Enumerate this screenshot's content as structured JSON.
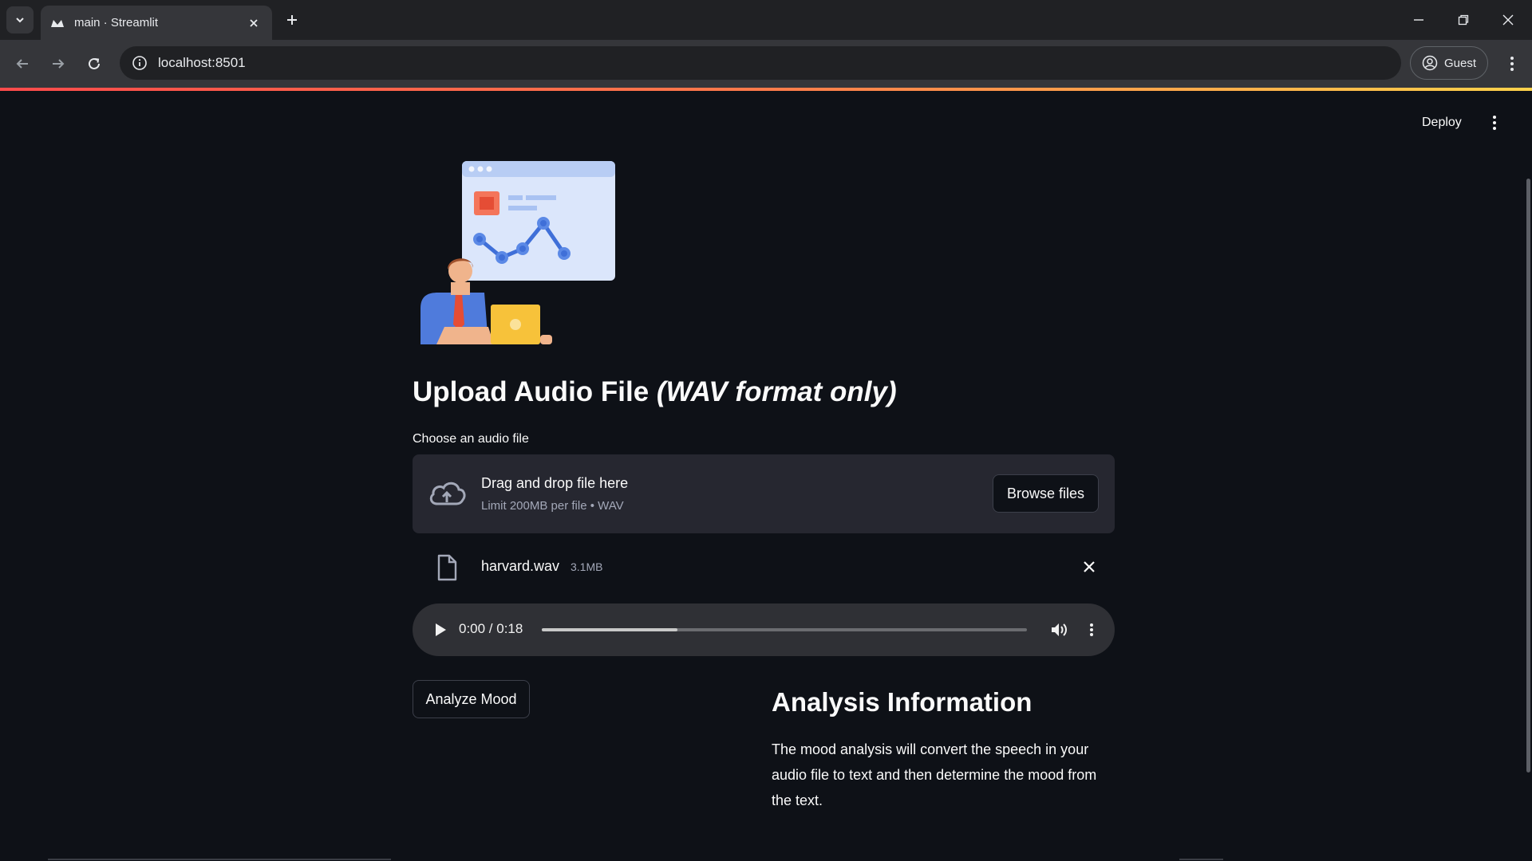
{
  "browser": {
    "tab_title": "main · Streamlit",
    "url": "localhost:8501",
    "profile_label": "Guest"
  },
  "app": {
    "deploy_label": "Deploy"
  },
  "uploader": {
    "heading": "Upload Audio File",
    "heading_italic": "(WAV format only)",
    "label": "Choose an audio file",
    "dropzone_title": "Drag and drop file here",
    "dropzone_limit": "Limit 200MB per file • WAV",
    "browse_label": "Browse files"
  },
  "file": {
    "name": "harvard.wav",
    "size": "3.1MB"
  },
  "audio": {
    "time": "0:00 / 0:18",
    "buffered_fraction": 0.28
  },
  "actions": {
    "analyze_label": "Analyze Mood"
  },
  "analysis": {
    "title": "Analysis Information",
    "text": "The mood analysis will convert the speech in your audio file to text and then determine the mood from the text."
  },
  "colors": {
    "background": "#0e1117",
    "surface": "#262730",
    "accent_red": "#ff4b4b",
    "accent_blue": "#4f7bdc",
    "accent_yellow": "#f7c23a"
  }
}
